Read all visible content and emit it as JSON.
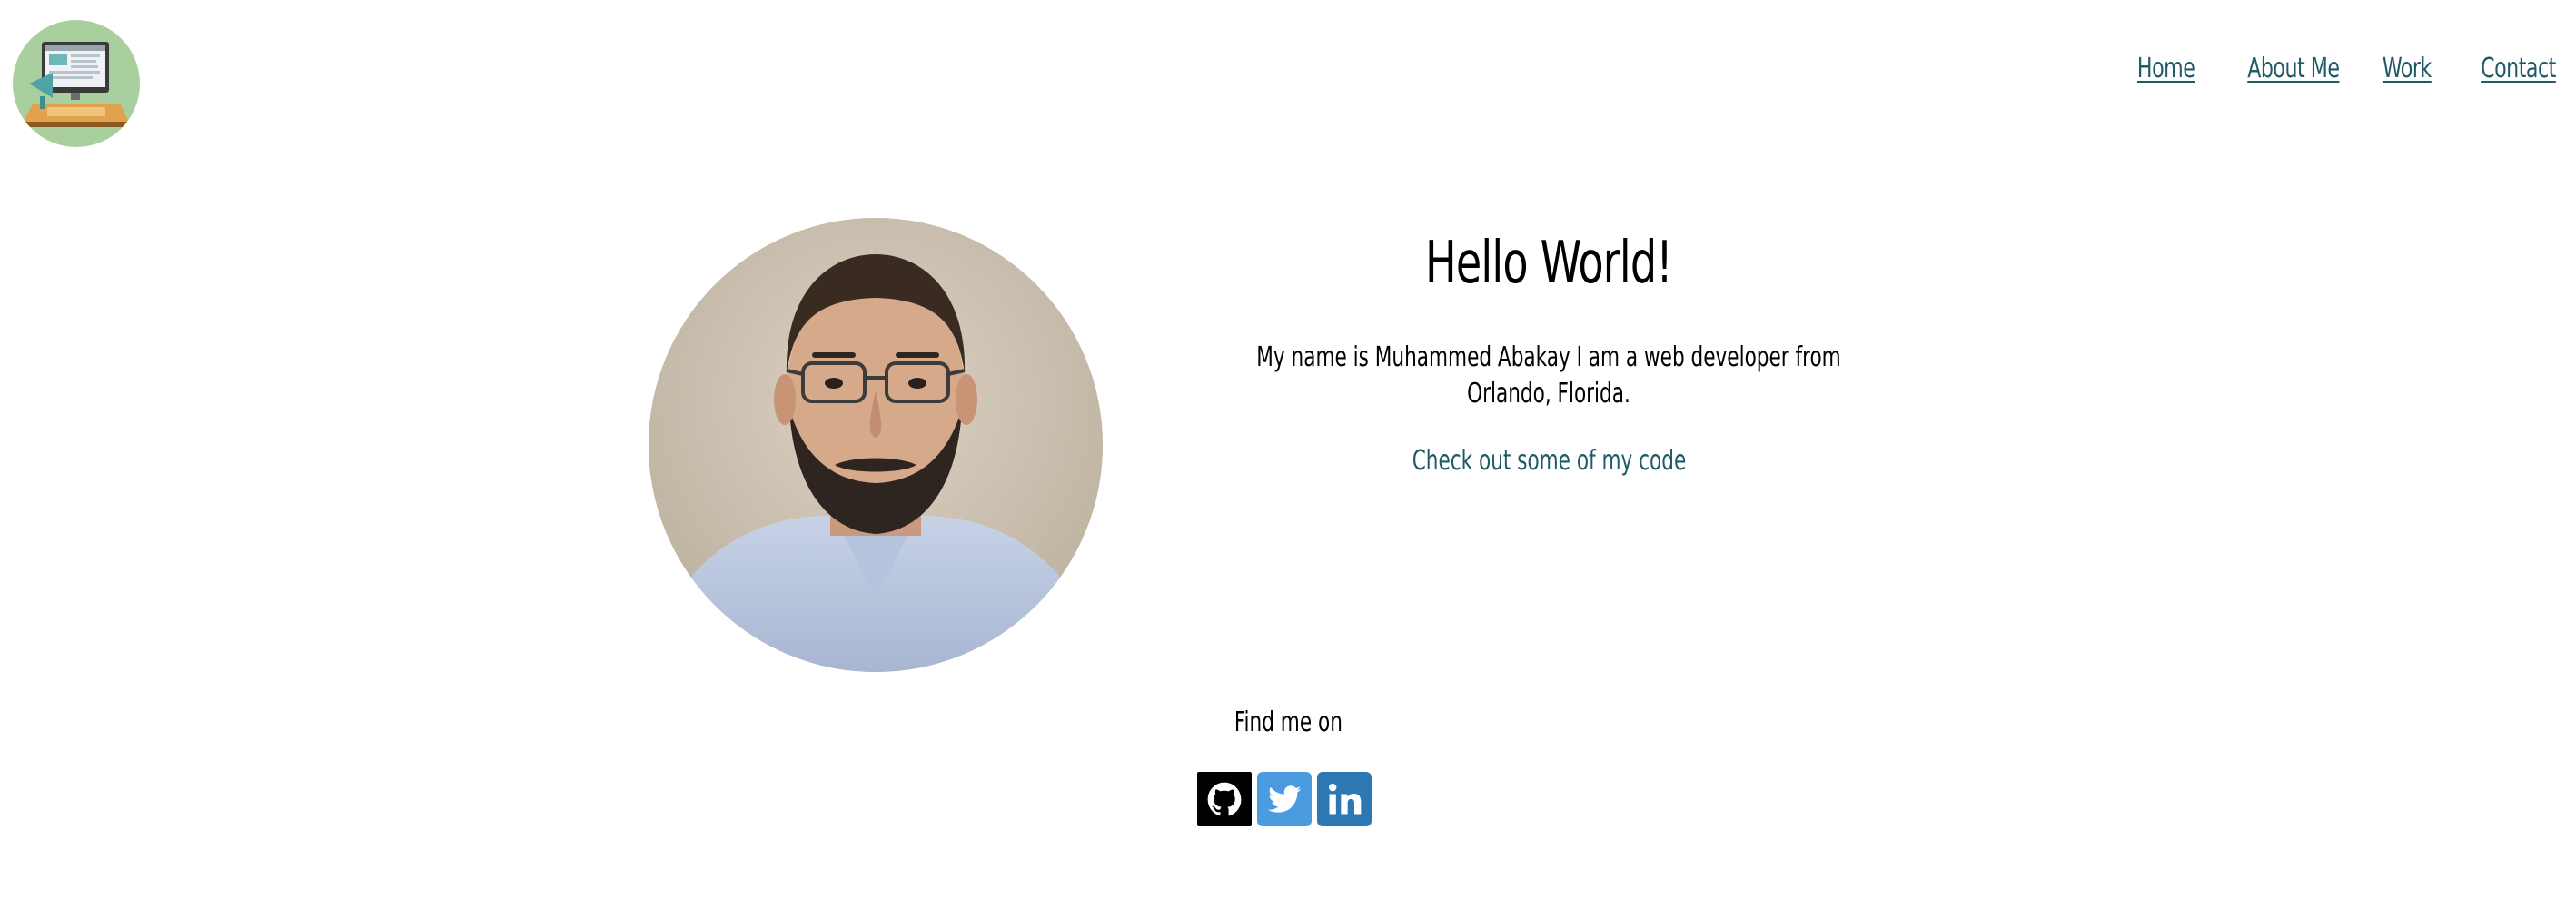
{
  "header": {
    "nav": [
      {
        "label": "Home"
      },
      {
        "label": "About Me"
      },
      {
        "label": "Work"
      },
      {
        "label": "Contact"
      }
    ],
    "logo_icon": "laptop-monitor-icon"
  },
  "main": {
    "heading": "Hello World!",
    "bio": "My name is Muhammed Abakay I am a web developer from Orlando, Florida.",
    "code_link": "Check out some of my code"
  },
  "social": {
    "label": "Find me on",
    "items": [
      {
        "name": "github",
        "icon": "github-icon",
        "color": "#000000"
      },
      {
        "name": "twitter",
        "icon": "twitter-icon",
        "color": "#4a9be0"
      },
      {
        "name": "linkedin",
        "icon": "linkedin-icon",
        "color": "#2d77b3"
      }
    ]
  },
  "colors": {
    "link": "#1f5a67",
    "logo_bg": "#a9cf9f"
  }
}
